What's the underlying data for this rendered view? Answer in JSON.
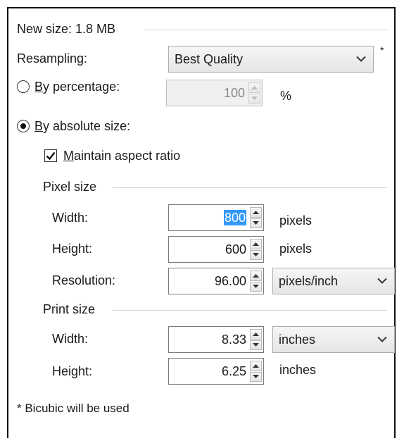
{
  "new_size": {
    "label": "New size: 1.8 MB"
  },
  "resampling": {
    "label": "Resampling:",
    "selected": "Best Quality",
    "asterisk": "*"
  },
  "by_percentage": {
    "label_prefix": "",
    "label_ul": "B",
    "label_rest": "y percentage:",
    "selected": false,
    "value": "100",
    "unit": "%"
  },
  "by_absolute": {
    "label_ul": "B",
    "label_rest": "y absolute size:",
    "selected": true
  },
  "maintain_aspect": {
    "label_ul": "M",
    "label_rest": "aintain aspect ratio",
    "checked": true
  },
  "pixel_size": {
    "title": "Pixel size",
    "width": {
      "label": "Width:",
      "value": "800",
      "unit": "pixels"
    },
    "height": {
      "label": "Height:",
      "value": "600",
      "unit": "pixels"
    },
    "resolution": {
      "label": "Resolution:",
      "value": "96.00",
      "unit": "pixels/inch"
    }
  },
  "print_size": {
    "title": "Print size",
    "width": {
      "label": "Width:",
      "value": "8.33",
      "unit": "inches"
    },
    "height": {
      "label": "Height:",
      "value": "6.25",
      "unit": "inches"
    }
  },
  "footnote": "* Bicubic will be used",
  "icons": {
    "chevron": "chevron-down-icon",
    "spin_up": "spin-up-icon",
    "spin_down": "spin-down-icon",
    "check": "checkmark-icon"
  },
  "colors": {
    "selection": "#3399ff",
    "border": "#111111",
    "group_line": "#d4d4d4"
  }
}
